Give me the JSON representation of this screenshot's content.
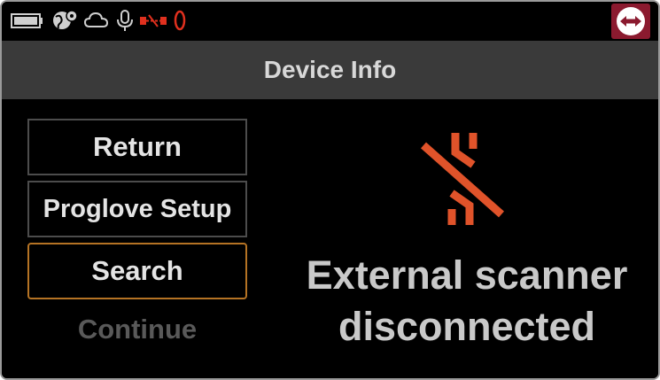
{
  "header": {
    "title": "Device Info"
  },
  "status_icons": [
    "battery-icon",
    "globe-icon",
    "cloud-icon",
    "microphone-icon",
    "scanner-link-icon",
    "ring-icon",
    "teamviewer-icon"
  ],
  "menu": {
    "return_label": "Return",
    "proglove_label": "Proglove Setup",
    "search_label": "Search",
    "continue_label": "Continue"
  },
  "message": {
    "line1": "External scanner",
    "line2": "disconnected"
  },
  "colors": {
    "accent": "#e0532a",
    "focus_border": "#b57324",
    "header_bg": "#3a3a3a",
    "teamviewer_bg": "#8b1a2f"
  }
}
